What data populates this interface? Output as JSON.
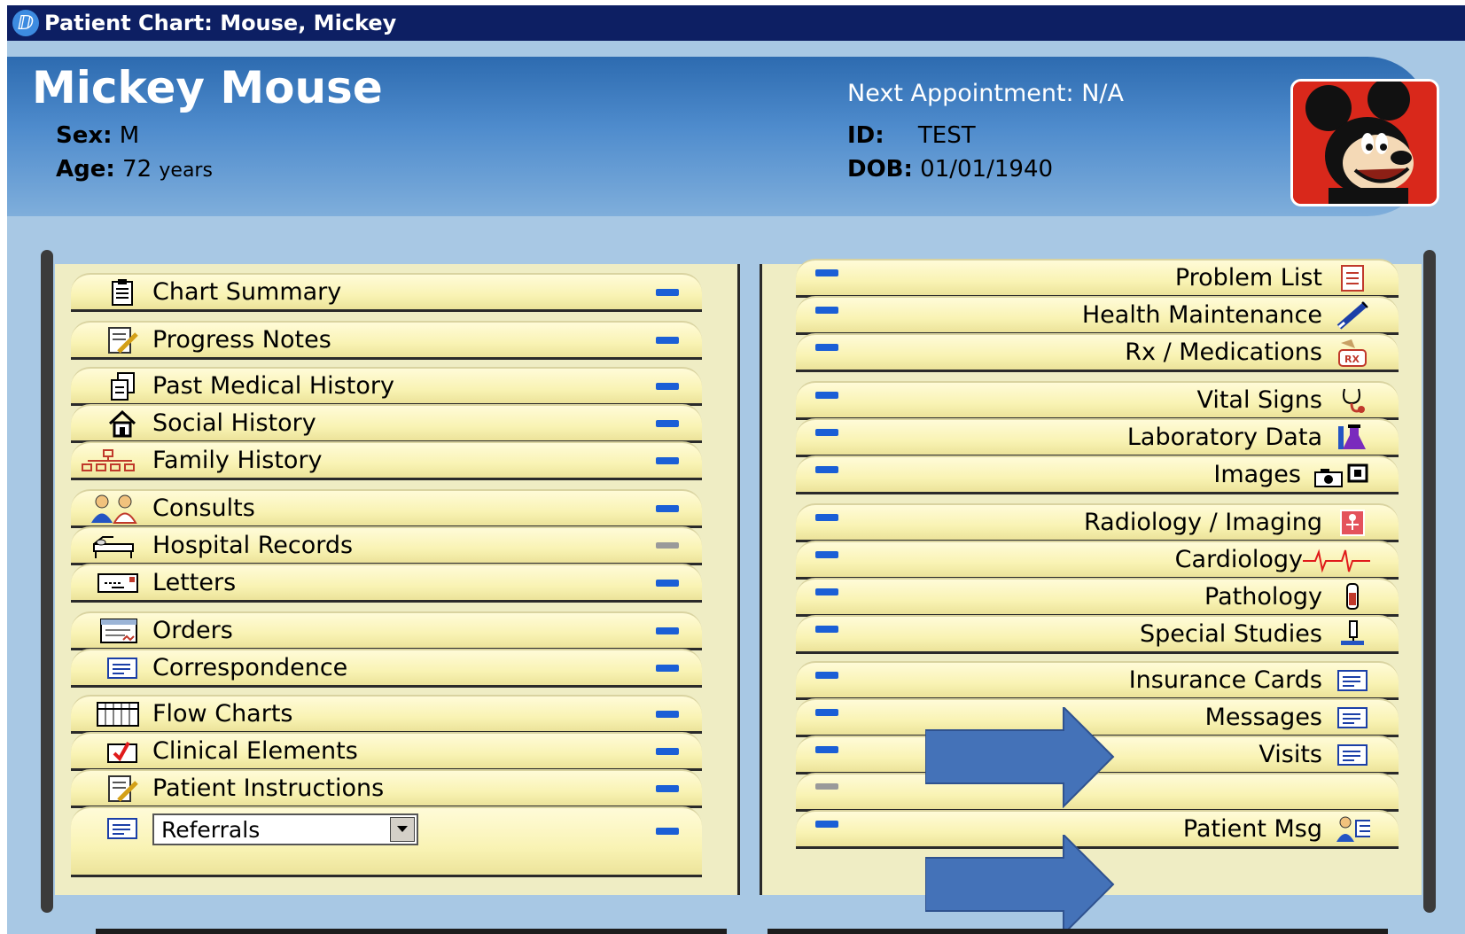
{
  "window": {
    "title": "Patient Chart: Mouse, Mickey"
  },
  "patient": {
    "name": "Mickey Mouse",
    "sex_label": "Sex:",
    "sex": "M",
    "age_label": "Age:",
    "age_value": "72",
    "age_unit": "years",
    "next_appointment": "Next Appointment: N/A",
    "id_label": "ID:",
    "id": "TEST",
    "dob_label": "DOB:",
    "dob": "01/01/1940"
  },
  "left_tabs": [
    {
      "label": "Chart Summary",
      "icon": "clipboard-icon"
    },
    {
      "label": "Progress Notes",
      "icon": "note-pencil-icon"
    },
    {
      "label": "Past Medical History",
      "icon": "documents-icon"
    },
    {
      "label": "Social History",
      "icon": "house-icon"
    },
    {
      "label": "Family History",
      "icon": "family-tree-icon"
    },
    {
      "label": "Consults",
      "icon": "people-icon"
    },
    {
      "label": "Hospital Records",
      "icon": "hospital-bed-icon"
    },
    {
      "label": "Letters",
      "icon": "envelope-icon"
    },
    {
      "label": "Orders",
      "icon": "order-form-icon"
    },
    {
      "label": "Correspondence",
      "icon": "document-lines-icon"
    },
    {
      "label": "Flow Charts",
      "icon": "grid-icon"
    },
    {
      "label": "Clinical Elements",
      "icon": "checkbox-icon"
    },
    {
      "label": "Patient Instructions",
      "icon": "note-pencil-icon"
    },
    {
      "label": "Referrals",
      "icon": "document-lines-icon"
    }
  ],
  "referrals_select": {
    "value": "Referrals"
  },
  "right_tabs": [
    {
      "label": "Problem List",
      "icon": "list-icon"
    },
    {
      "label": "Health Maintenance",
      "icon": "syringe-icon"
    },
    {
      "label": "Rx / Medications",
      "icon": "rx-bottle-icon"
    },
    {
      "label": "Vital Signs",
      "icon": "stethoscope-icon"
    },
    {
      "label": "Laboratory Data",
      "icon": "lab-flask-icon"
    },
    {
      "label": "Images",
      "icon": "camera-icon"
    },
    {
      "label": "Radiology / Imaging",
      "icon": "xray-icon"
    },
    {
      "label": "Cardiology",
      "icon": "ekg-icon"
    },
    {
      "label": "Pathology",
      "icon": "specimen-tube-icon"
    },
    {
      "label": "Special Studies",
      "icon": "microscope-icon"
    },
    {
      "label": "Insurance Cards",
      "icon": "document-lines-icon"
    },
    {
      "label": "Messages",
      "icon": "document-lines-icon"
    },
    {
      "label": "Visits",
      "icon": "document-lines-icon"
    },
    {
      "label": "",
      "icon": ""
    },
    {
      "label": "Patient Msg",
      "icon": "patient-message-icon"
    }
  ],
  "colors": {
    "titlebar": "#0d1f63",
    "header": "#4f8ccd",
    "tab": "#f9f3b4",
    "flag": "#1b5fd6",
    "annotation_arrow": "#4472b8"
  }
}
